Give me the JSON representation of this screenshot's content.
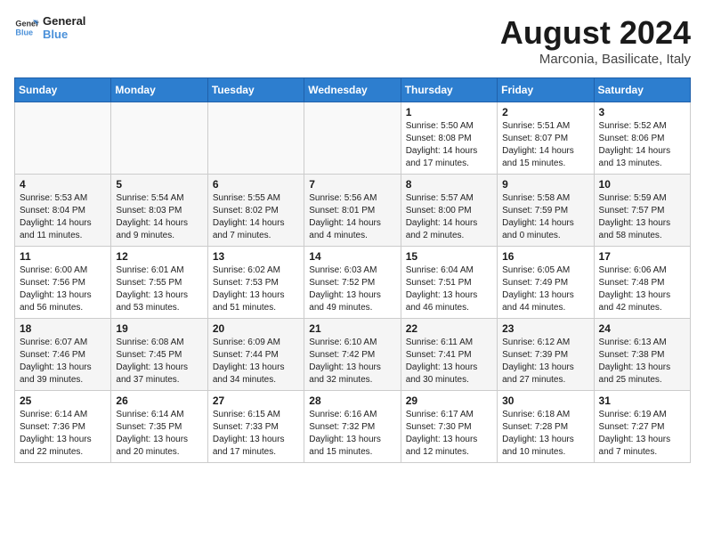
{
  "header": {
    "logo_line1": "General",
    "logo_line2": "Blue",
    "month_year": "August 2024",
    "location": "Marconia, Basilicate, Italy"
  },
  "days_of_week": [
    "Sunday",
    "Monday",
    "Tuesday",
    "Wednesday",
    "Thursday",
    "Friday",
    "Saturday"
  ],
  "weeks": [
    [
      {
        "day": "",
        "info": ""
      },
      {
        "day": "",
        "info": ""
      },
      {
        "day": "",
        "info": ""
      },
      {
        "day": "",
        "info": ""
      },
      {
        "day": "1",
        "sunrise": "5:50 AM",
        "sunset": "8:08 PM",
        "daylight": "14 hours and 17 minutes."
      },
      {
        "day": "2",
        "sunrise": "5:51 AM",
        "sunset": "8:07 PM",
        "daylight": "14 hours and 15 minutes."
      },
      {
        "day": "3",
        "sunrise": "5:52 AM",
        "sunset": "8:06 PM",
        "daylight": "14 hours and 13 minutes."
      }
    ],
    [
      {
        "day": "4",
        "sunrise": "5:53 AM",
        "sunset": "8:04 PM",
        "daylight": "14 hours and 11 minutes."
      },
      {
        "day": "5",
        "sunrise": "5:54 AM",
        "sunset": "8:03 PM",
        "daylight": "14 hours and 9 minutes."
      },
      {
        "day": "6",
        "sunrise": "5:55 AM",
        "sunset": "8:02 PM",
        "daylight": "14 hours and 7 minutes."
      },
      {
        "day": "7",
        "sunrise": "5:56 AM",
        "sunset": "8:01 PM",
        "daylight": "14 hours and 4 minutes."
      },
      {
        "day": "8",
        "sunrise": "5:57 AM",
        "sunset": "8:00 PM",
        "daylight": "14 hours and 2 minutes."
      },
      {
        "day": "9",
        "sunrise": "5:58 AM",
        "sunset": "7:59 PM",
        "daylight": "14 hours and 0 minutes."
      },
      {
        "day": "10",
        "sunrise": "5:59 AM",
        "sunset": "7:57 PM",
        "daylight": "13 hours and 58 minutes."
      }
    ],
    [
      {
        "day": "11",
        "sunrise": "6:00 AM",
        "sunset": "7:56 PM",
        "daylight": "13 hours and 56 minutes."
      },
      {
        "day": "12",
        "sunrise": "6:01 AM",
        "sunset": "7:55 PM",
        "daylight": "13 hours and 53 minutes."
      },
      {
        "day": "13",
        "sunrise": "6:02 AM",
        "sunset": "7:53 PM",
        "daylight": "13 hours and 51 minutes."
      },
      {
        "day": "14",
        "sunrise": "6:03 AM",
        "sunset": "7:52 PM",
        "daylight": "13 hours and 49 minutes."
      },
      {
        "day": "15",
        "sunrise": "6:04 AM",
        "sunset": "7:51 PM",
        "daylight": "13 hours and 46 minutes."
      },
      {
        "day": "16",
        "sunrise": "6:05 AM",
        "sunset": "7:49 PM",
        "daylight": "13 hours and 44 minutes."
      },
      {
        "day": "17",
        "sunrise": "6:06 AM",
        "sunset": "7:48 PM",
        "daylight": "13 hours and 42 minutes."
      }
    ],
    [
      {
        "day": "18",
        "sunrise": "6:07 AM",
        "sunset": "7:46 PM",
        "daylight": "13 hours and 39 minutes."
      },
      {
        "day": "19",
        "sunrise": "6:08 AM",
        "sunset": "7:45 PM",
        "daylight": "13 hours and 37 minutes."
      },
      {
        "day": "20",
        "sunrise": "6:09 AM",
        "sunset": "7:44 PM",
        "daylight": "13 hours and 34 minutes."
      },
      {
        "day": "21",
        "sunrise": "6:10 AM",
        "sunset": "7:42 PM",
        "daylight": "13 hours and 32 minutes."
      },
      {
        "day": "22",
        "sunrise": "6:11 AM",
        "sunset": "7:41 PM",
        "daylight": "13 hours and 30 minutes."
      },
      {
        "day": "23",
        "sunrise": "6:12 AM",
        "sunset": "7:39 PM",
        "daylight": "13 hours and 27 minutes."
      },
      {
        "day": "24",
        "sunrise": "6:13 AM",
        "sunset": "7:38 PM",
        "daylight": "13 hours and 25 minutes."
      }
    ],
    [
      {
        "day": "25",
        "sunrise": "6:14 AM",
        "sunset": "7:36 PM",
        "daylight": "13 hours and 22 minutes."
      },
      {
        "day": "26",
        "sunrise": "6:14 AM",
        "sunset": "7:35 PM",
        "daylight": "13 hours and 20 minutes."
      },
      {
        "day": "27",
        "sunrise": "6:15 AM",
        "sunset": "7:33 PM",
        "daylight": "13 hours and 17 minutes."
      },
      {
        "day": "28",
        "sunrise": "6:16 AM",
        "sunset": "7:32 PM",
        "daylight": "13 hours and 15 minutes."
      },
      {
        "day": "29",
        "sunrise": "6:17 AM",
        "sunset": "7:30 PM",
        "daylight": "13 hours and 12 minutes."
      },
      {
        "day": "30",
        "sunrise": "6:18 AM",
        "sunset": "7:28 PM",
        "daylight": "13 hours and 10 minutes."
      },
      {
        "day": "31",
        "sunrise": "6:19 AM",
        "sunset": "7:27 PM",
        "daylight": "13 hours and 7 minutes."
      }
    ]
  ]
}
